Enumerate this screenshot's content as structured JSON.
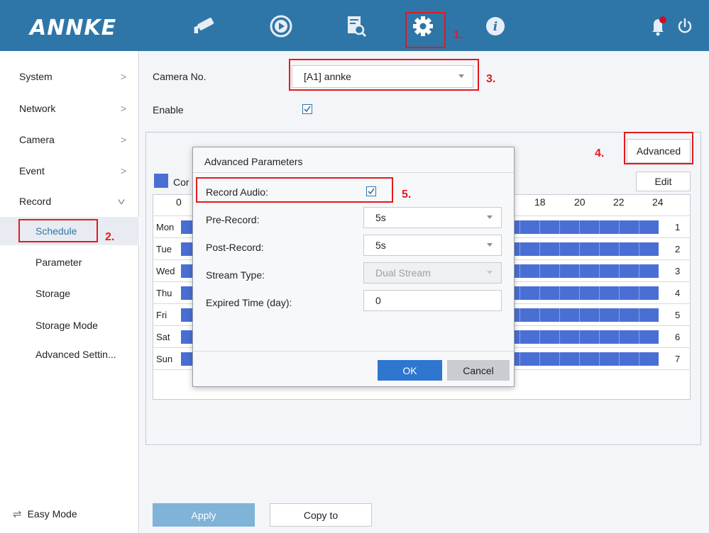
{
  "header": {
    "logo": "ANNKE",
    "nav_icons": [
      "camera-icon",
      "playback-icon",
      "search-icon",
      "settings-gear-icon",
      "info-icon"
    ],
    "right_icons": [
      "notification-bell-icon",
      "power-icon"
    ]
  },
  "sidebar": {
    "items": [
      {
        "label": "System",
        "chevron": ">"
      },
      {
        "label": "Network",
        "chevron": ">"
      },
      {
        "label": "Camera",
        "chevron": ">"
      },
      {
        "label": "Event",
        "chevron": ">"
      },
      {
        "label": "Record",
        "chevron": "v"
      }
    ],
    "sub_items": [
      {
        "label": "Schedule"
      },
      {
        "label": "Parameter"
      },
      {
        "label": "Storage"
      },
      {
        "label": "Storage Mode"
      },
      {
        "label": "Advanced Settin..."
      }
    ],
    "easy_mode": "Easy Mode"
  },
  "main": {
    "camera_label": "Camera No.",
    "camera_value": "[A1] annke",
    "enable_label": "Enable",
    "enable_checked": true,
    "advanced_button": "Advanced",
    "edit_button": "Edit",
    "legend_label": "Cor",
    "hours": [
      "0",
      "18",
      "20",
      "22",
      "24"
    ],
    "days": [
      {
        "name": "Mon",
        "num": "1"
      },
      {
        "name": "Tue",
        "num": "2"
      },
      {
        "name": "Wed",
        "num": "3"
      },
      {
        "name": "Thu",
        "num": "4"
      },
      {
        "name": "Fri",
        "num": "5"
      },
      {
        "name": "Sat",
        "num": "6"
      },
      {
        "name": "Sun",
        "num": "7"
      }
    ],
    "apply_button": "Apply",
    "copy_button": "Copy to"
  },
  "modal": {
    "title": "Advanced Parameters",
    "record_audio_label": "Record Audio:",
    "record_audio_checked": true,
    "pre_record_label": "Pre-Record:",
    "pre_record_value": "5s",
    "post_record_label": "Post-Record:",
    "post_record_value": "5s",
    "stream_type_label": "Stream Type:",
    "stream_type_value": "Dual Stream",
    "expired_label": "Expired Time (day):",
    "expired_value": "0",
    "ok_button": "OK",
    "cancel_button": "Cancel"
  },
  "annotations": [
    "1.",
    "2.",
    "3.",
    "4.",
    "5."
  ],
  "colors": {
    "header_bg": "#2f76a8",
    "schedule_bar": "#4a6fd4",
    "annotation_red": "#e5191c",
    "ok_blue": "#2f76d0"
  }
}
